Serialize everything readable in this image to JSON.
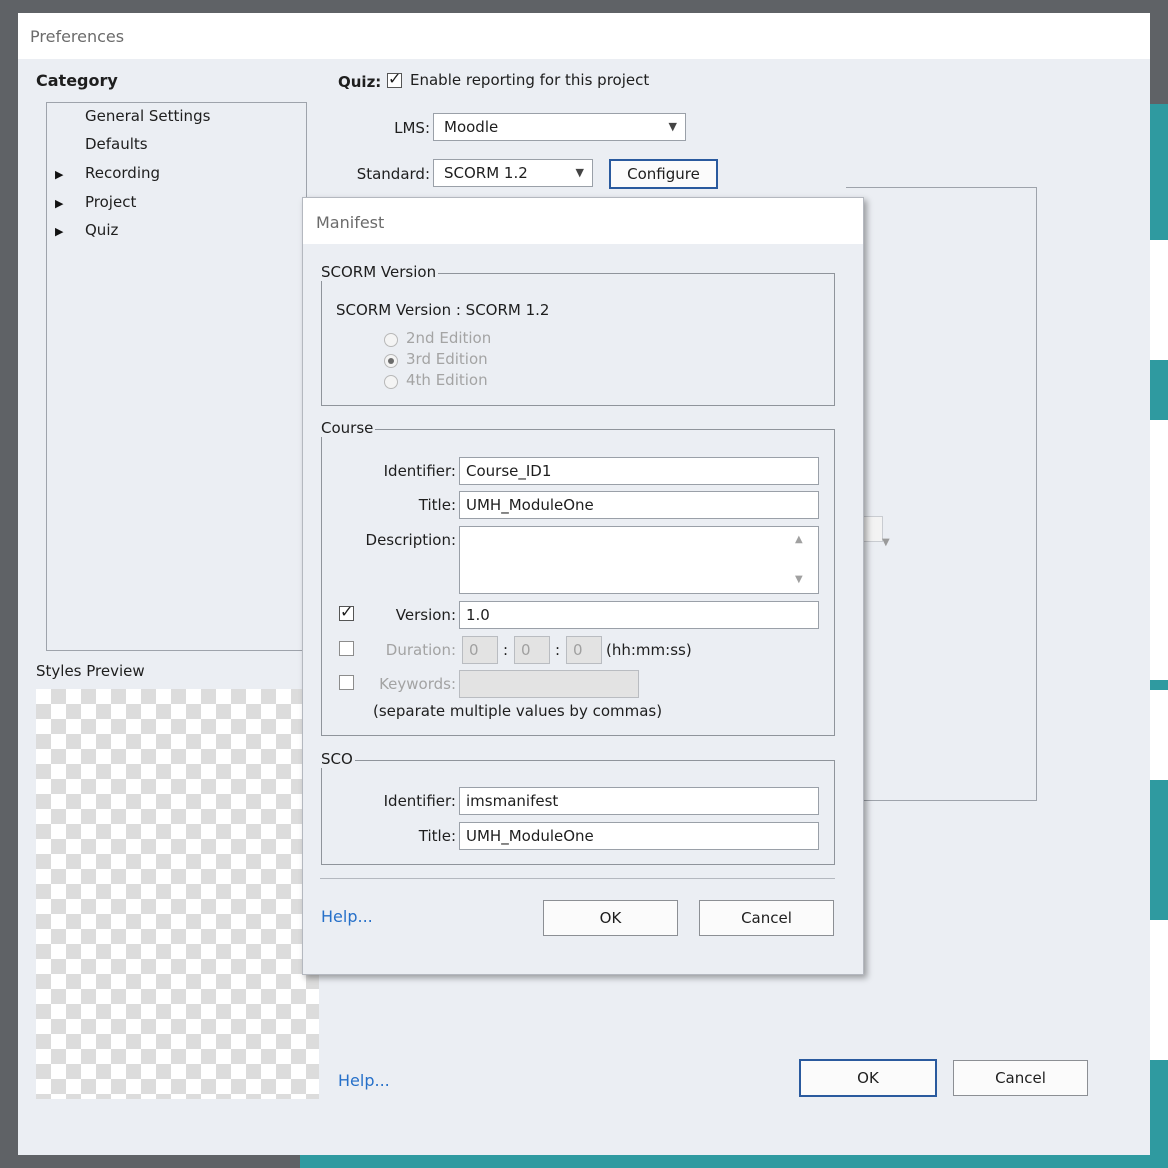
{
  "preferences": {
    "title": "Preferences",
    "category_heading": "Category",
    "tree": [
      {
        "label": "General Settings",
        "expandable": false
      },
      {
        "label": "Defaults",
        "expandable": false
      },
      {
        "label": "Recording",
        "expandable": true
      },
      {
        "label": "Project",
        "expandable": true
      },
      {
        "label": "Quiz",
        "expandable": true
      }
    ],
    "styles_preview_label": "Styles Preview",
    "quiz_label": "Quiz:",
    "enable_reporting": {
      "label": "Enable reporting for this project",
      "checked": true
    },
    "lms": {
      "label": "LMS:",
      "value": "Moodle"
    },
    "standard": {
      "label": "Standard:",
      "value": "SCORM 1.2"
    },
    "configure_label": "Configure",
    "help_label": "Help...",
    "ok_label": "OK",
    "cancel_label": "Cancel"
  },
  "manifest": {
    "title": "Manifest",
    "scorm_group": {
      "title": "SCORM Version",
      "version_text": "SCORM Version : SCORM 1.2",
      "editions": [
        {
          "label": "2nd Edition",
          "selected": false
        },
        {
          "label": "3rd Edition",
          "selected": true
        },
        {
          "label": "4th Edition",
          "selected": false
        }
      ]
    },
    "course_group": {
      "title": "Course",
      "identifier": {
        "label": "Identifier:",
        "value": "Course_ID1"
      },
      "title_field": {
        "label": "Title:",
        "value": "UMH_ModuleOne"
      },
      "description": {
        "label": "Description:",
        "value": ""
      },
      "version": {
        "label": "Version:",
        "value": "1.0",
        "checked": true
      },
      "duration": {
        "label": "Duration:",
        "hh": "0",
        "mm": "0",
        "ss": "0",
        "format": "(hh:mm:ss)",
        "checked": false,
        "sep": ":"
      },
      "keywords": {
        "label": "Keywords:",
        "value": "",
        "checked": false,
        "hint": "(separate multiple values by commas)"
      }
    },
    "sco_group": {
      "title": "SCO",
      "identifier": {
        "label": "Identifier:",
        "value": "imsmanifest"
      },
      "title_field": {
        "label": "Title:",
        "value": "UMH_ModuleOne"
      }
    },
    "help_label": "Help...",
    "ok_label": "OK",
    "cancel_label": "Cancel"
  },
  "colors": {
    "accent": "#2a5a9e",
    "link": "#2670c9",
    "window_bg": "#ebeef3",
    "bg_app": "#2f9aa0"
  }
}
